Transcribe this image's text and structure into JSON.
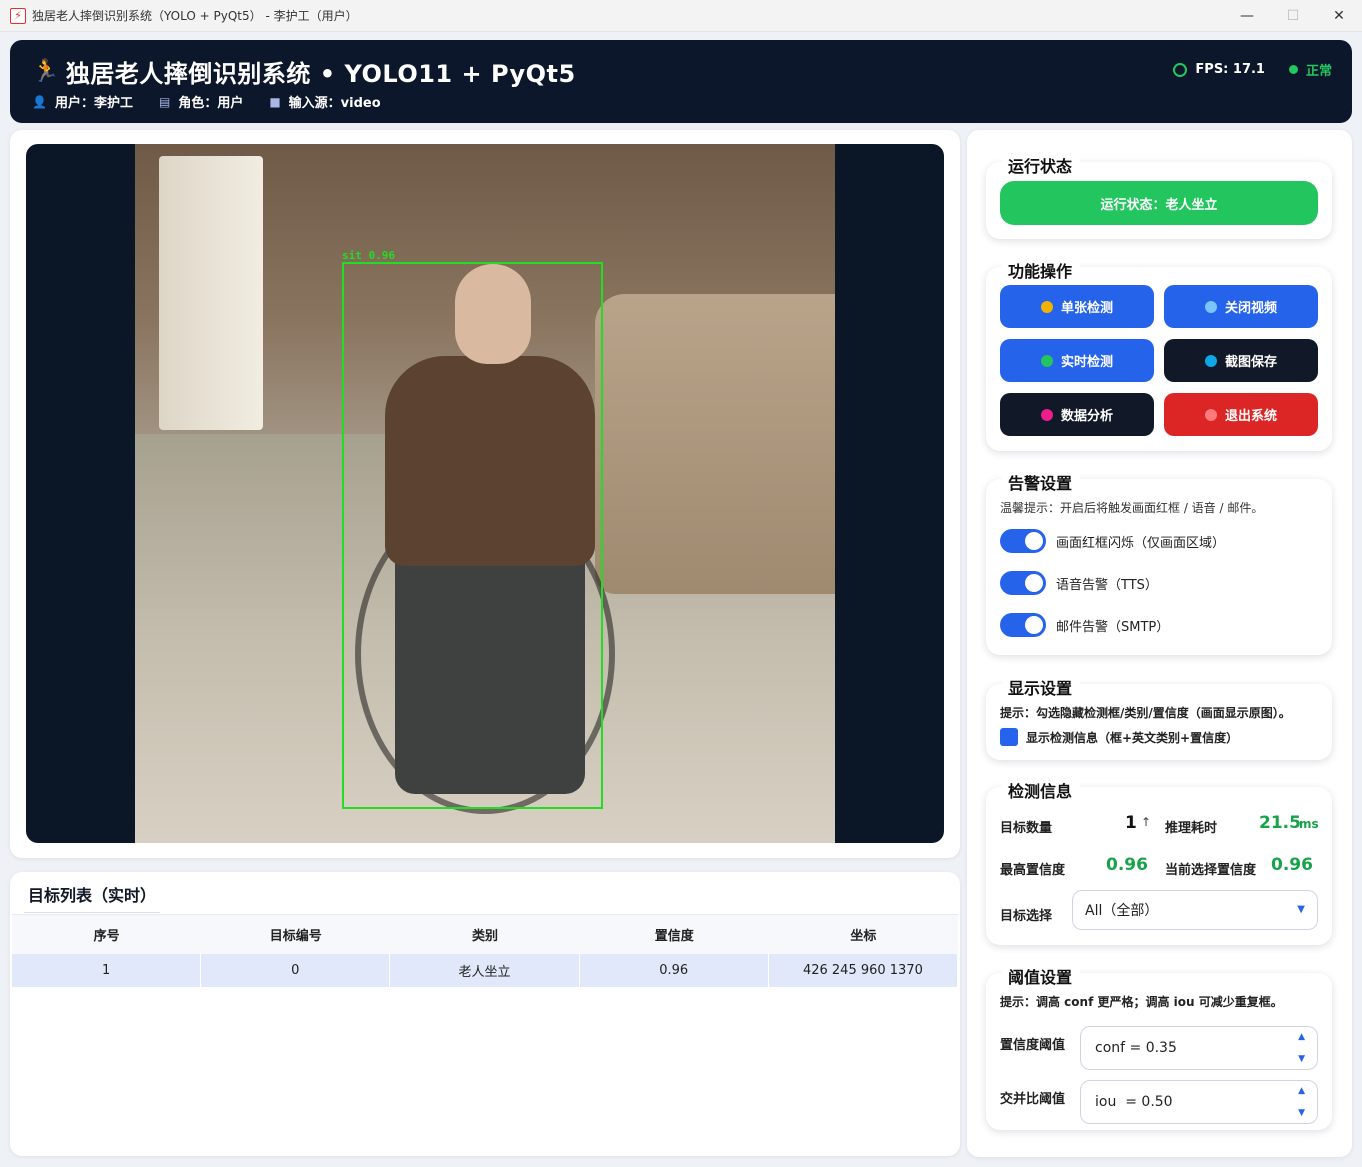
{
  "window": {
    "title": "独居老人摔倒识别系统（YOLO + PyQt5） - 李护工（用户）",
    "minimize": "—",
    "maximize": "☐",
    "close": "✕"
  },
  "header": {
    "title": "独居老人摔倒识别系统 • YOLO11 + PyQt5",
    "user": "用户：李护工",
    "role": "角色：用户",
    "source": "输入源：video",
    "fps": "FPS: 17.1",
    "status": "正常"
  },
  "video": {
    "detection_label": "sit 0.96"
  },
  "target_list": {
    "title": "目标列表（实时）",
    "columns": [
      "序号",
      "目标编号",
      "类别",
      "置信度",
      "坐标"
    ],
    "rows": [
      [
        "1",
        "0",
        "老人坐立",
        "0.96",
        "426 245 960 1370"
      ]
    ]
  },
  "run_state": {
    "title": "运行状态",
    "status_text": "运行状态：老人坐立"
  },
  "functions": {
    "title": "功能操作",
    "buttons": [
      {
        "label": "单张检测",
        "dot": "#f5b301"
      },
      {
        "label": "关闭视频",
        "dot": "#7cc4ff"
      },
      {
        "label": "实时检测",
        "dot": "#22c55e"
      },
      {
        "label": "截图保存",
        "dot": "#0ea5e9"
      },
      {
        "label": "数据分析",
        "dot": "#ec1e8c"
      },
      {
        "label": "退出系统",
        "dot": "#ff7a7a"
      }
    ]
  },
  "alarm": {
    "title": "告警设置",
    "tip": "温馨提示：开启后将触发画面红框 / 语音 / 邮件。",
    "toggles": [
      {
        "label": "画面红框闪烁（仅画面区域）",
        "on": true
      },
      {
        "label": "语音告警（TTS）",
        "on": true
      },
      {
        "label": "邮件告警（SMTP）",
        "on": true
      }
    ]
  },
  "display": {
    "title": "显示设置",
    "tip": "提示：勾选隐藏检测框/类别/置信度（画面显示原图）。",
    "checkbox_label": "显示检测信息（框+英文类别+置信度）"
  },
  "detection": {
    "title": "检测信息",
    "count_label": "目标数量",
    "count_value": "1",
    "infer_label": "推理耗时",
    "infer_value": "21.5",
    "infer_unit": "ms",
    "max_conf_label": "最高置信度",
    "max_conf_value": "0.96",
    "cur_conf_label": "当前选择置信度",
    "cur_conf_value": "0.96",
    "select_label": "目标选择",
    "select_value": "All（全部）"
  },
  "threshold": {
    "title": "阈值设置",
    "tip": "提示：调高 conf 更严格；调高 iou 可减少重复框。",
    "conf_label": "置信度阈值",
    "conf_value": "conf = 0.35",
    "iou_label": "交并比阈值",
    "iou_value": "iou  = 0.50"
  }
}
